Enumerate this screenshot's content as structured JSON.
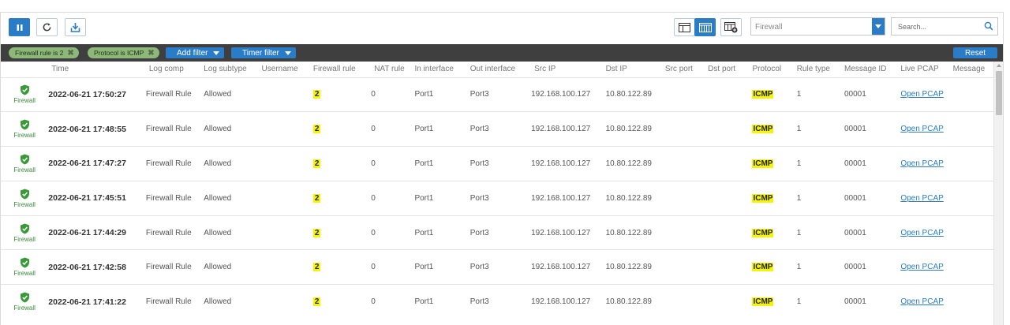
{
  "toolbar": {
    "filter_select_value": "Firewall",
    "search_placeholder": "Search..."
  },
  "filterbar": {
    "chips": [
      "Firewall rule is 2",
      "Protocol is ICMP"
    ],
    "add_filter_label": "Add filter",
    "timer_filter_label": "Timer filter",
    "reset_label": "Reset"
  },
  "table": {
    "columns": [
      "",
      "Time",
      "Log comp",
      "Log subtype",
      "Username",
      "Firewall rule",
      "NAT rule",
      "In interface",
      "Out interface",
      "Src IP",
      "Dst IP",
      "Src port",
      "Dst port",
      "Protocol",
      "Rule type",
      "Message ID",
      "Live PCAP",
      "Message"
    ],
    "rows": [
      {
        "icon_label": "Firewall",
        "time": "2022-06-21 17:50:27",
        "log_comp": "Firewall Rule",
        "log_subtype": "Allowed",
        "username": "",
        "firewall_rule": "2",
        "nat_rule": "0",
        "in_interface": "Port1",
        "out_interface": "Port3",
        "src_ip": "192.168.100.127",
        "dst_ip": "10.80.122.89",
        "src_port": "",
        "dst_port": "",
        "protocol": "ICMP",
        "rule_type": "1",
        "message_id": "00001",
        "live_pcap": "Open PCAP",
        "message": ""
      },
      {
        "icon_label": "Firewall",
        "time": "2022-06-21 17:48:55",
        "log_comp": "Firewall Rule",
        "log_subtype": "Allowed",
        "username": "",
        "firewall_rule": "2",
        "nat_rule": "0",
        "in_interface": "Port1",
        "out_interface": "Port3",
        "src_ip": "192.168.100.127",
        "dst_ip": "10.80.122.89",
        "src_port": "",
        "dst_port": "",
        "protocol": "ICMP",
        "rule_type": "1",
        "message_id": "00001",
        "live_pcap": "Open PCAP",
        "message": ""
      },
      {
        "icon_label": "Firewall",
        "time": "2022-06-21 17:47:27",
        "log_comp": "Firewall Rule",
        "log_subtype": "Allowed",
        "username": "",
        "firewall_rule": "2",
        "nat_rule": "0",
        "in_interface": "Port1",
        "out_interface": "Port3",
        "src_ip": "192.168.100.127",
        "dst_ip": "10.80.122.89",
        "src_port": "",
        "dst_port": "",
        "protocol": "ICMP",
        "rule_type": "1",
        "message_id": "00001",
        "live_pcap": "Open PCAP",
        "message": ""
      },
      {
        "icon_label": "Firewall",
        "time": "2022-06-21 17:45:51",
        "log_comp": "Firewall Rule",
        "log_subtype": "Allowed",
        "username": "",
        "firewall_rule": "2",
        "nat_rule": "0",
        "in_interface": "Port1",
        "out_interface": "Port3",
        "src_ip": "192.168.100.127",
        "dst_ip": "10.80.122.89",
        "src_port": "",
        "dst_port": "",
        "protocol": "ICMP",
        "rule_type": "1",
        "message_id": "00001",
        "live_pcap": "Open PCAP",
        "message": ""
      },
      {
        "icon_label": "Firewall",
        "time": "2022-06-21 17:44:29",
        "log_comp": "Firewall Rule",
        "log_subtype": "Allowed",
        "username": "",
        "firewall_rule": "2",
        "nat_rule": "0",
        "in_interface": "Port1",
        "out_interface": "Port3",
        "src_ip": "192.168.100.127",
        "dst_ip": "10.80.122.89",
        "src_port": "",
        "dst_port": "",
        "protocol": "ICMP",
        "rule_type": "1",
        "message_id": "00001",
        "live_pcap": "Open PCAP",
        "message": ""
      },
      {
        "icon_label": "Firewall",
        "time": "2022-06-21 17:42:58",
        "log_comp": "Firewall Rule",
        "log_subtype": "Allowed",
        "username": "",
        "firewall_rule": "2",
        "nat_rule": "0",
        "in_interface": "Port1",
        "out_interface": "Port3",
        "src_ip": "192.168.100.127",
        "dst_ip": "10.80.122.89",
        "src_port": "",
        "dst_port": "",
        "protocol": "ICMP",
        "rule_type": "1",
        "message_id": "00001",
        "live_pcap": "Open PCAP",
        "message": ""
      },
      {
        "icon_label": "Firewall",
        "time": "2022-06-21 17:41:22",
        "log_comp": "Firewall Rule",
        "log_subtype": "Allowed",
        "username": "",
        "firewall_rule": "2",
        "nat_rule": "0",
        "in_interface": "Port1",
        "out_interface": "Port3",
        "src_ip": "192.168.100.127",
        "dst_ip": "10.80.122.89",
        "src_port": "",
        "dst_port": "",
        "protocol": "ICMP",
        "rule_type": "1",
        "message_id": "00001",
        "live_pcap": "Open PCAP",
        "message": ""
      }
    ]
  },
  "colors": {
    "accent": "#2a7cc7",
    "filterbar_bg": "#3f3f3f",
    "chip_bg": "#8db87a",
    "highlight": "#f5f500",
    "shield_green": "#3a9a3a"
  },
  "icons": {
    "pause": "pause-icon",
    "refresh": "refresh-icon",
    "export": "export-icon",
    "row_status": "shield-check-icon"
  }
}
